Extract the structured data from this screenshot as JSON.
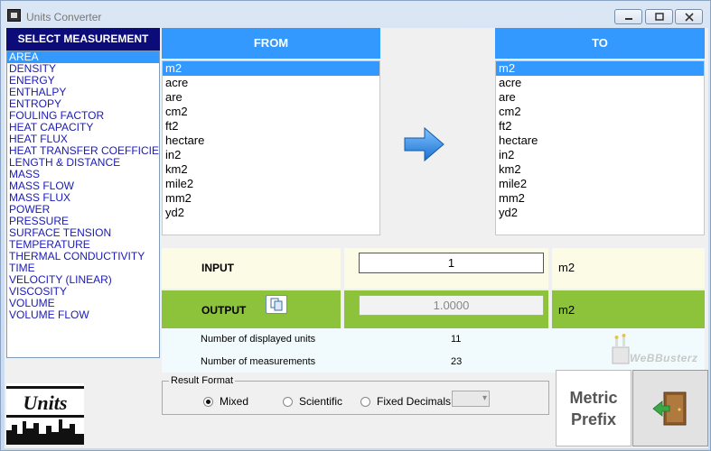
{
  "window": {
    "title": "Units Converter"
  },
  "measurements": {
    "header": "SELECT MEASUREMENT",
    "items": [
      "AREA",
      "DENSITY",
      "ENERGY",
      "ENTHALPY",
      "ENTROPY",
      "FOULING FACTOR",
      "HEAT CAPACITY",
      "HEAT FLUX",
      "HEAT TRANSFER COEFFICIENT",
      "LENGTH & DISTANCE",
      "MASS",
      "MASS FLOW",
      "MASS FLUX",
      "POWER",
      "PRESSURE",
      "SURFACE TENSION",
      "TEMPERATURE",
      "THERMAL CONDUCTIVITY",
      "TIME",
      "VELOCITY (LINEAR)",
      "VISCOSITY",
      "VOLUME",
      "VOLUME FLOW"
    ],
    "selected": "AREA"
  },
  "from": {
    "header": "FROM",
    "units": [
      "m2",
      "acre",
      "are",
      "cm2",
      "ft2",
      "hectare",
      "in2",
      "km2",
      "mile2",
      "mm2",
      "yd2"
    ],
    "selected": "m2"
  },
  "to": {
    "header": "TO",
    "units": [
      "m2",
      "acre",
      "are",
      "cm2",
      "ft2",
      "hectare",
      "in2",
      "km2",
      "mile2",
      "mm2",
      "yd2"
    ],
    "selected": "m2"
  },
  "input": {
    "label": "INPUT",
    "value": "1",
    "unit": "m2"
  },
  "output": {
    "label": "OUTPUT",
    "value": "1.0000",
    "unit": "m2"
  },
  "info": {
    "displayed_units_label": "Number of displayed units",
    "displayed_units_value": "11",
    "measurements_label": "Number of measurements",
    "measurements_value": "23"
  },
  "watermark": "WeBBusterz",
  "result_format": {
    "legend": "Result Format",
    "options": [
      "Mixed",
      "Scientific",
      "Fixed Decimals"
    ],
    "selected": "Mixed"
  },
  "logo_text": "Units",
  "metric_prefix": {
    "line1": "Metric",
    "line2": "Prefix"
  },
  "icons": {
    "arrow": "arrow-right-icon",
    "copy": "copy-icon",
    "exit": "exit-door-icon"
  },
  "colors": {
    "accent_blue": "#3399ff",
    "navy": "#0b0b7a",
    "output_green": "#8dc33b",
    "input_yellow": "#fcfce6"
  }
}
